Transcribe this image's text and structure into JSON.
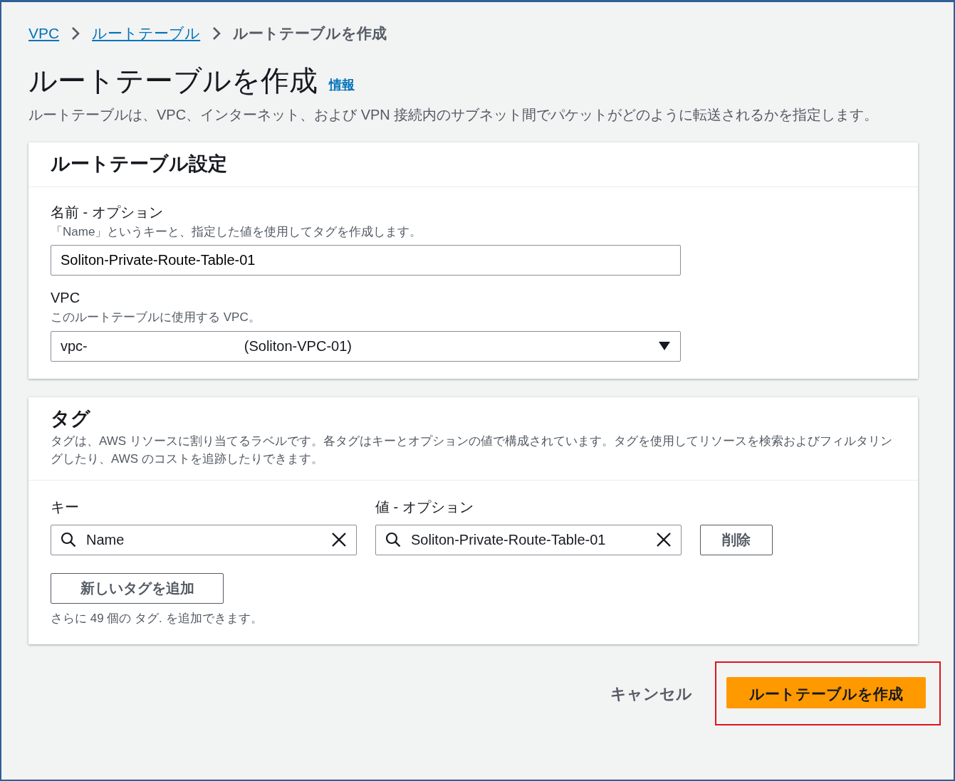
{
  "breadcrumb": [
    {
      "label": "VPC",
      "kind": "link"
    },
    {
      "label": "ルートテーブル",
      "kind": "link"
    },
    {
      "label": "ルートテーブルを作成",
      "kind": "current"
    }
  ],
  "page": {
    "title": "ルートテーブルを作成",
    "info_link": "情報",
    "description": "ルートテーブルは、VPC、インターネット、および VPN 接続内のサブネット間でパケットがどのように転送されるかを指定します。"
  },
  "settings": {
    "title": "ルートテーブル設定",
    "fields": [
      {
        "kind": "text",
        "label": "名前 - オプション",
        "hint": "「Name」というキーと、指定した値を使用してタグを作成します。",
        "value": "Soliton-Private-Route-Table-01"
      },
      {
        "kind": "select",
        "label": "VPC",
        "hint": "このルートテーブルに使用する VPC。",
        "value": "vpc-",
        "value_name": "(Soliton-VPC-01)"
      }
    ]
  },
  "tags": {
    "title": "タグ",
    "description": "タグは、AWS リソースに割り当てるラベルです。各タグはキーとオプションの値で構成されています。タグを使用してリソースを検索およびフィルタリングしたり、AWS のコストを追跡したりできます。",
    "key_label": "キー",
    "value_label": "値 - オプション",
    "rows": [
      {
        "key": "Name",
        "value": "Soliton-Private-Route-Table-01",
        "remove": "削除"
      }
    ],
    "add_button": "新しいタグを追加",
    "remaining": "さらに 49 個の タグ. を追加できます。"
  },
  "footer": {
    "cancel": "キャンセル",
    "submit": "ルートテーブルを作成",
    "submit_highlighted": true
  }
}
